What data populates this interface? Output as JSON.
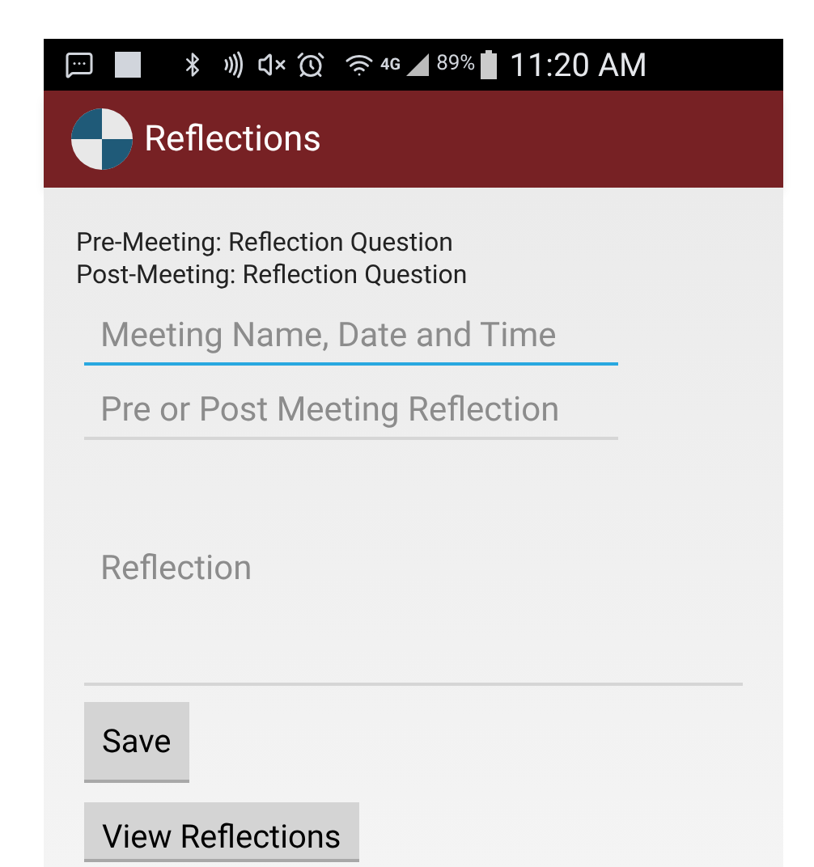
{
  "status_bar": {
    "network_type": "4G",
    "battery": "89%",
    "time": "11:20 AM"
  },
  "app_bar": {
    "title": "Reflections"
  },
  "questions": [
    "Pre-Meeting: Reflection Question",
    "Post-Meeting: Reflection Question"
  ],
  "fields": [
    {
      "kind": "line",
      "placeholder": "Meeting Name, Date and Time",
      "focused": true
    },
    {
      "kind": "line",
      "placeholder": "Pre or Post Meeting Reflection",
      "focused": false
    },
    {
      "kind": "multiline",
      "placeholder": "Reflection",
      "focused": false
    }
  ],
  "buttons": [
    "Save",
    "View Reflections"
  ]
}
